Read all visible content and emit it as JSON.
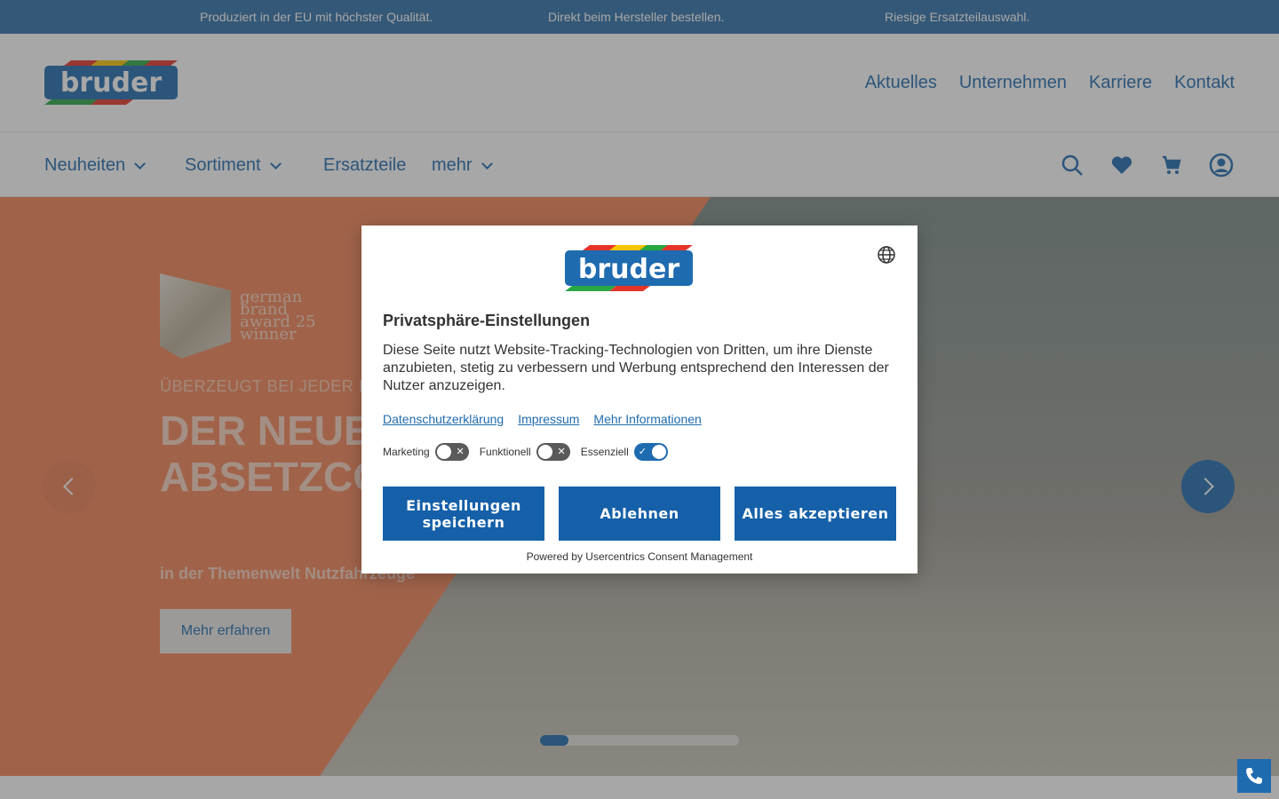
{
  "topbar": {
    "items": [
      "Produziert in der EU mit höchster Qualität.",
      "Direkt beim Hersteller bestellen.",
      "Riesige Ersatzteilauswahl."
    ]
  },
  "header": {
    "logo_text": "bruder",
    "topnav": [
      "Aktuelles",
      "Unternehmen",
      "Karriere",
      "Kontakt"
    ]
  },
  "mainnav": {
    "items": [
      "Neuheiten",
      "Sortiment",
      "Ersatzteile",
      "mehr"
    ],
    "icons": [
      "search-icon",
      "heart-icon",
      "cart-icon",
      "user-icon"
    ]
  },
  "hero": {
    "award_text": "german brand award 25 winner",
    "eyebrow": "ÜBERZEUGT BEI JEDER HE",
    "headline": "DER NEUE ABSETZCO LKW",
    "subline": "in der Themenwelt Nutzfahrzeuge",
    "button": "Mehr erfahren"
  },
  "dialog": {
    "title": "Privatsphäre-Einstellungen",
    "text": "Diese Seite nutzt Website-Tracking-Technologien von Dritten, um ihre Dienste anzubieten, stetig zu verbessern und Werbung entsprechend den Interessen der Nutzer anzuzeigen.",
    "links": [
      "Datenschutzerklärung",
      "Impressum",
      "Mehr Informationen"
    ],
    "toggles": [
      {
        "label": "Marketing",
        "state": "off"
      },
      {
        "label": "Funktionell",
        "state": "off"
      },
      {
        "label": "Essenziell",
        "state": "on"
      }
    ],
    "buttons": {
      "save": "Einstellungen speichern",
      "decline": "Ablehnen",
      "accept": "Alles akzeptieren"
    },
    "powered": "Powered by Usercentrics Consent Management"
  },
  "colors": {
    "brand_blue": "#1f6bb0",
    "hero_orange": "#f28457",
    "button_blue": "#1560a8"
  }
}
